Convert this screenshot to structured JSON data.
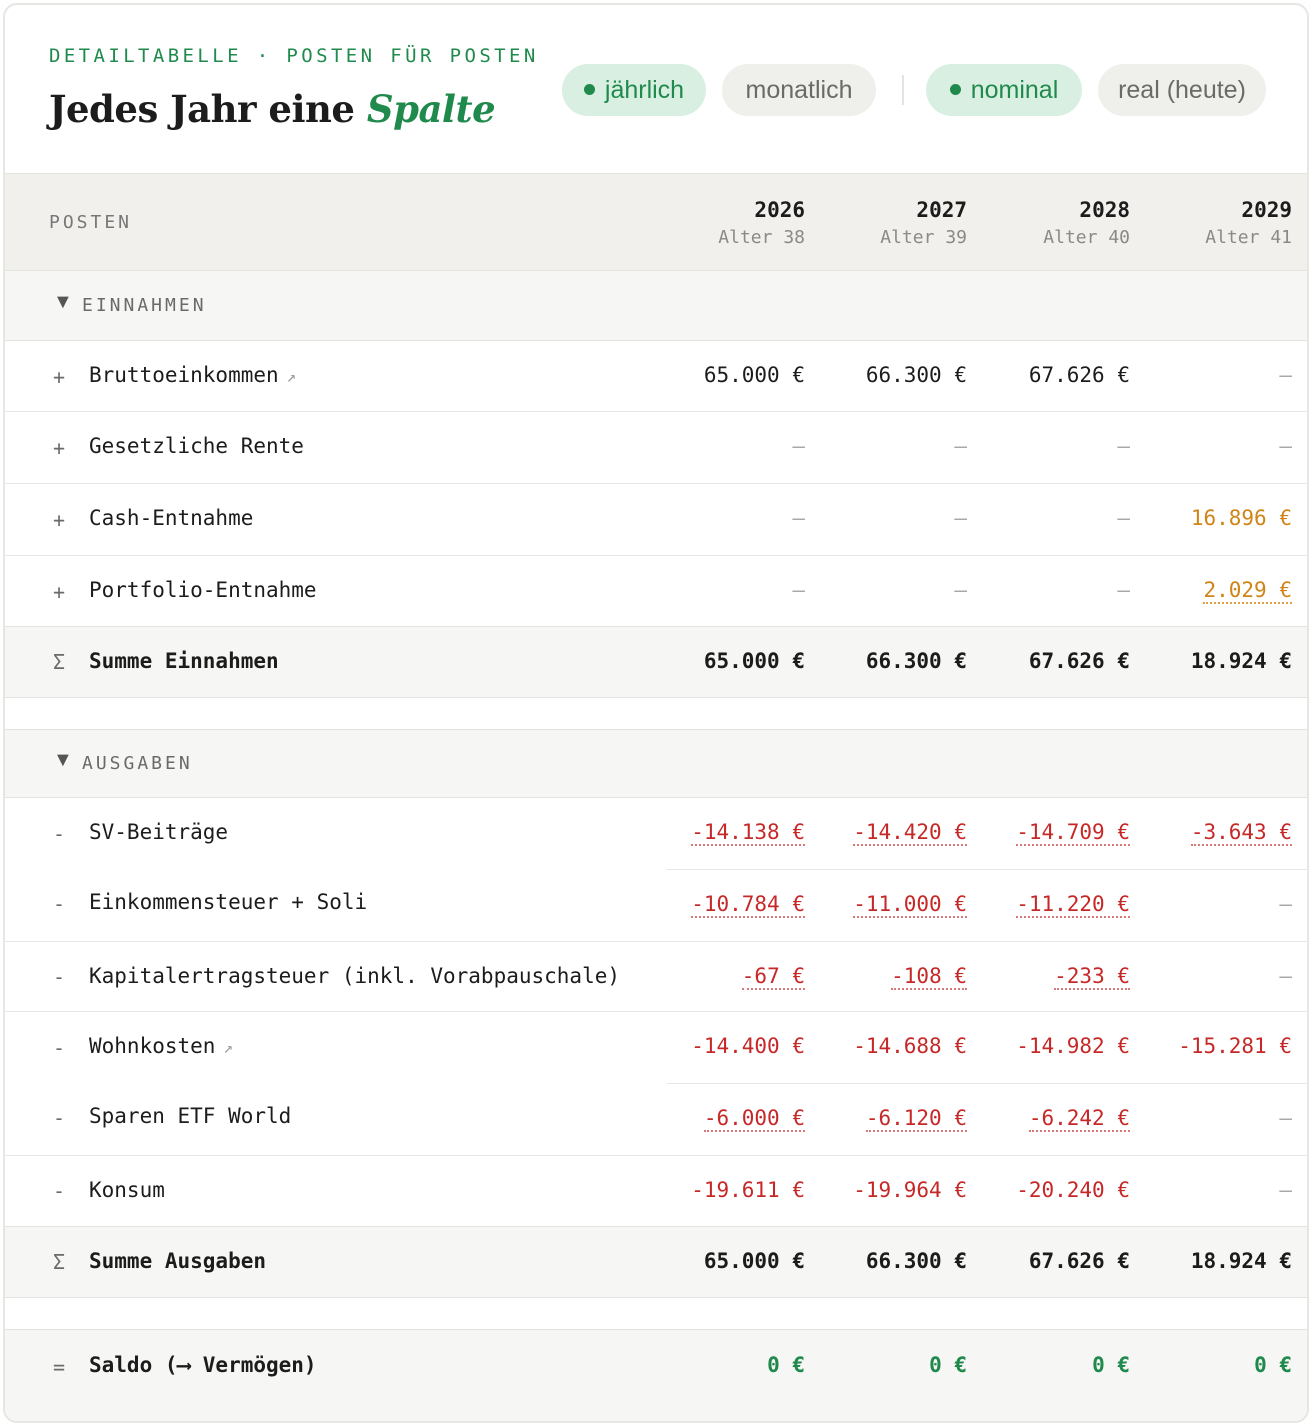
{
  "header": {
    "eyebrow": "DETAILTABELLE · POSTEN FÜR POSTEN",
    "title_main": "Jedes Jahr eine ",
    "title_accent": "Spalte"
  },
  "toggles": {
    "period": [
      {
        "label": "jährlich",
        "active": true
      },
      {
        "label": "monatlich",
        "active": false
      }
    ],
    "value": [
      {
        "label": "nominal",
        "active": true
      },
      {
        "label": "real (heute)",
        "active": false
      }
    ]
  },
  "table": {
    "posten_header": "POSTEN",
    "columns": [
      {
        "year": "2026",
        "age": "Alter 38"
      },
      {
        "year": "2027",
        "age": "Alter 39"
      },
      {
        "year": "2028",
        "age": "Alter 40"
      },
      {
        "year": "2029",
        "age": "Alter 41"
      }
    ],
    "income": {
      "title": "EINNAHMEN",
      "rows": [
        {
          "sign": "+",
          "label": "Bruttoeinkommen",
          "arrow": "↗",
          "values": [
            "65.000 €",
            "66.300 €",
            "67.626 €",
            "—"
          ]
        },
        {
          "sign": "+",
          "label": "Gesetzliche Rente",
          "values": [
            "—",
            "—",
            "—",
            "—"
          ]
        },
        {
          "sign": "+",
          "label": "Cash-Entnahme",
          "values": [
            "—",
            "—",
            "—",
            "16.896 €"
          ]
        },
        {
          "sign": "+",
          "label": "Portfolio-Entnahme",
          "values": [
            "—",
            "—",
            "—",
            "2.029 €"
          ]
        }
      ],
      "sum": {
        "sign": "Σ",
        "label": "Summe Einnahmen",
        "values": [
          "65.000 €",
          "66.300 €",
          "67.626 €",
          "18.924 €"
        ]
      }
    },
    "expenses": {
      "title": "AUSGABEN",
      "rows": [
        {
          "sign": "-",
          "label": "SV-Beiträge",
          "values": [
            "-14.138 €",
            "-14.420 €",
            "-14.709 €",
            "-3.643 €"
          ]
        },
        {
          "sign": "-",
          "label": "Einkommensteuer + Soli",
          "values": [
            "-10.784 €",
            "-11.000 €",
            "-11.220 €",
            "—"
          ]
        },
        {
          "sign": "-",
          "label": "Kapitalertragsteuer (inkl. Vorabpauschale)",
          "values": [
            "-67 €",
            "-108 €",
            "-233 €",
            "—"
          ]
        },
        {
          "sign": "-",
          "label": "Wohnkosten",
          "arrow": "↗",
          "values": [
            "-14.400 €",
            "-14.688 €",
            "-14.982 €",
            "-15.281 €"
          ]
        },
        {
          "sign": "-",
          "label": "Sparen ETF World",
          "values": [
            "-6.000 €",
            "-6.120 €",
            "-6.242 €",
            "—"
          ]
        },
        {
          "sign": "-",
          "label": "Konsum",
          "values": [
            "-19.611 €",
            "-19.964 €",
            "-20.240 €",
            "—"
          ]
        }
      ],
      "sum": {
        "sign": "Σ",
        "label": "Summe Ausgaben",
        "values": [
          "65.000 €",
          "66.300 €",
          "67.626 €",
          "18.924 €"
        ]
      }
    },
    "saldo": {
      "sign": "=",
      "label": "Saldo (⟶ Vermögen)",
      "values": [
        "0 €",
        "0 €",
        "0 €",
        "0 €"
      ]
    }
  },
  "colors": {
    "accent_green": "#1f8a4c",
    "negative_red": "#c62828",
    "withdrawal_orange": "#d08416"
  }
}
